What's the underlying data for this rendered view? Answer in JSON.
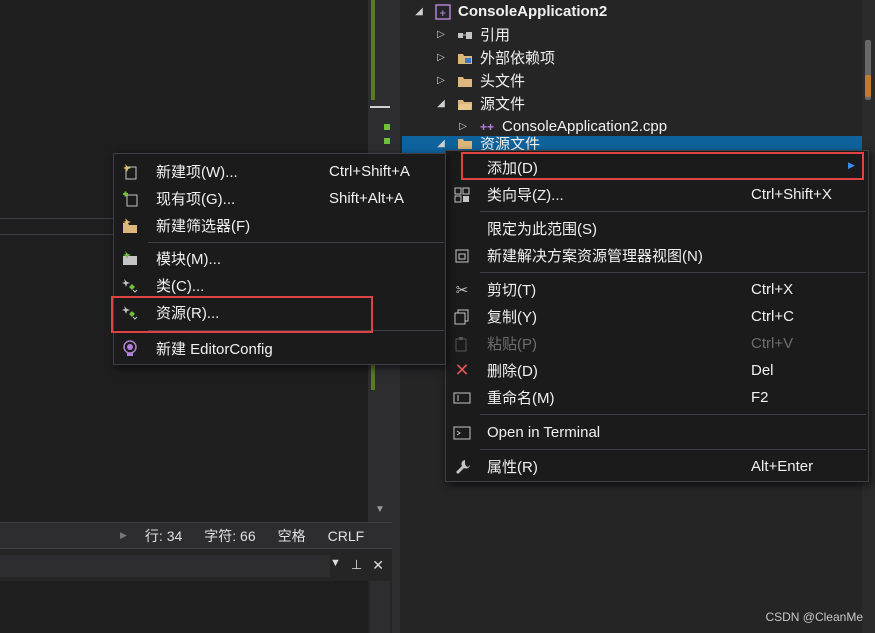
{
  "solution_explorer": {
    "project": "ConsoleApplication2",
    "items": [
      {
        "label": "引用"
      },
      {
        "label": "外部依赖项"
      },
      {
        "label": "头文件"
      },
      {
        "label": "源文件"
      },
      {
        "label": "ConsoleApplication2.cpp"
      },
      {
        "label": "资源文件"
      }
    ]
  },
  "context_menu": {
    "items": [
      {
        "label": "添加(D)",
        "shortcut": ""
      },
      {
        "label": "类向导(Z)...",
        "shortcut": "Ctrl+Shift+X"
      },
      {
        "label": "限定为此范围(S)",
        "shortcut": ""
      },
      {
        "label": "新建解决方案资源管理器视图(N)",
        "shortcut": ""
      },
      {
        "label": "剪切(T)",
        "shortcut": "Ctrl+X"
      },
      {
        "label": "复制(Y)",
        "shortcut": "Ctrl+C"
      },
      {
        "label": "粘贴(P)",
        "shortcut": "Ctrl+V"
      },
      {
        "label": "删除(D)",
        "shortcut": "Del"
      },
      {
        "label": "重命名(M)",
        "shortcut": "F2"
      },
      {
        "label": "Open in Terminal",
        "shortcut": ""
      },
      {
        "label": "属性(R)",
        "shortcut": "Alt+Enter"
      }
    ]
  },
  "add_submenu": {
    "items": [
      {
        "label": "新建项(W)...",
        "shortcut": "Ctrl+Shift+A"
      },
      {
        "label": "现有项(G)...",
        "shortcut": "Shift+Alt+A"
      },
      {
        "label": "新建筛选器(F)",
        "shortcut": ""
      },
      {
        "label": "模块(M)...",
        "shortcut": ""
      },
      {
        "label": "类(C)...",
        "shortcut": ""
      },
      {
        "label": "资源(R)...",
        "shortcut": ""
      },
      {
        "label": "新建 EditorConfig",
        "shortcut": ""
      }
    ]
  },
  "statusbar": {
    "line": "行: 34",
    "char": "字符: 66",
    "spaces": "空格",
    "eol": "CRLF"
  },
  "bottom_panel": {
    "dropdown_icon": "▼",
    "pin_icon": "📌",
    "close_icon": "✕"
  },
  "watermark": "CSDN @CleanMe",
  "colors": {
    "accent": "#0e639c",
    "highlight": "#e04343",
    "menu_bg": "#1b1b1c"
  }
}
